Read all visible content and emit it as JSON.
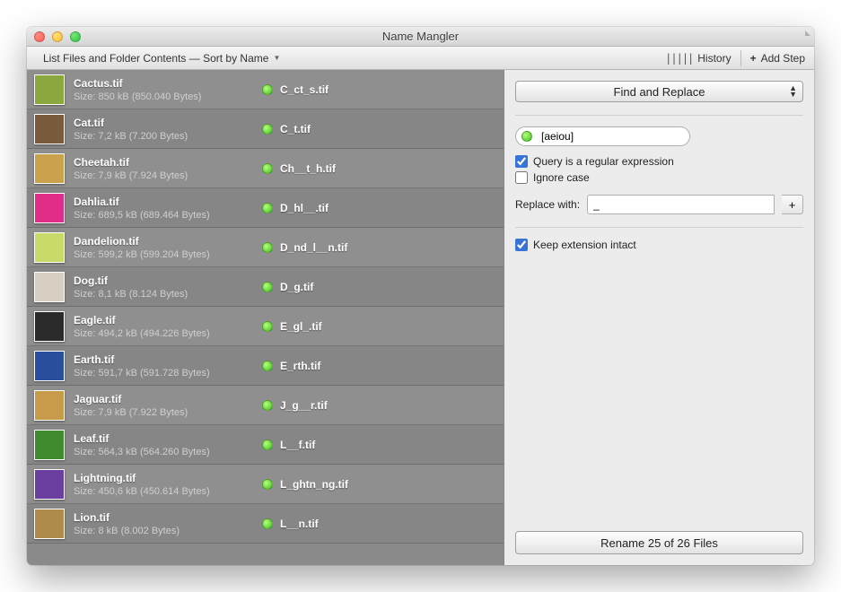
{
  "window": {
    "title": "Name Mangler"
  },
  "toolbar": {
    "list_label": "List Files and Folder Contents — Sort by Name",
    "history_label": "History",
    "add_step_label": "Add Step"
  },
  "files": [
    {
      "name": "Cactus.tif",
      "size": "Size: 850 kB (850.040 Bytes)",
      "new": "C_ct_s.tif",
      "thumb": "#8aa83e"
    },
    {
      "name": "Cat.tif",
      "size": "Size: 7,2 kB (7.200 Bytes)",
      "new": "C_t.tif",
      "thumb": "#7a5a3c"
    },
    {
      "name": "Cheetah.tif",
      "size": "Size: 7,9 kB (7.924 Bytes)",
      "new": "Ch__t_h.tif",
      "thumb": "#caa24e"
    },
    {
      "name": "Dahlia.tif",
      "size": "Size: 689,5 kB (689.464 Bytes)",
      "new": "D_hl__.tif",
      "thumb": "#e02d88"
    },
    {
      "name": "Dandelion.tif",
      "size": "Size: 599,2 kB (599.204 Bytes)",
      "new": "D_nd_l__n.tif",
      "thumb": "#c9d96a"
    },
    {
      "name": "Dog.tif",
      "size": "Size: 8,1 kB (8.124 Bytes)",
      "new": "D_g.tif",
      "thumb": "#d7cfc2"
    },
    {
      "name": "Eagle.tif",
      "size": "Size: 494,2 kB (494.226 Bytes)",
      "new": "E_gl_.tif",
      "thumb": "#2a2a2a"
    },
    {
      "name": "Earth.tif",
      "size": "Size: 591,7 kB (591.728 Bytes)",
      "new": "E_rth.tif",
      "thumb": "#2a4e9e"
    },
    {
      "name": "Jaguar.tif",
      "size": "Size: 7,9 kB (7.922 Bytes)",
      "new": "J_g__r.tif",
      "thumb": "#c79b4a"
    },
    {
      "name": "Leaf.tif",
      "size": "Size: 564,3 kB (564.260 Bytes)",
      "new": "L__f.tif",
      "thumb": "#3f8b2e"
    },
    {
      "name": "Lightning.tif",
      "size": "Size: 450,6 kB (450.614 Bytes)",
      "new": "L_ghtn_ng.tif",
      "thumb": "#6a3fa0"
    },
    {
      "name": "Lion.tif",
      "size": "Size: 8 kB (8.002 Bytes)",
      "new": "L__n.tif",
      "thumb": "#b08a4a"
    }
  ],
  "action": {
    "selected": "Find and Replace"
  },
  "form": {
    "query_value": "[aeiou]",
    "regex_label": "Query is a regular expression",
    "regex_checked": true,
    "ignorecase_label": "Ignore case",
    "ignorecase_checked": false,
    "replace_label": "Replace with:",
    "replace_value": "_",
    "keep_ext_label": "Keep extension intact",
    "keep_ext_checked": true
  },
  "footer": {
    "rename_label": "Rename 25 of 26 Files"
  }
}
